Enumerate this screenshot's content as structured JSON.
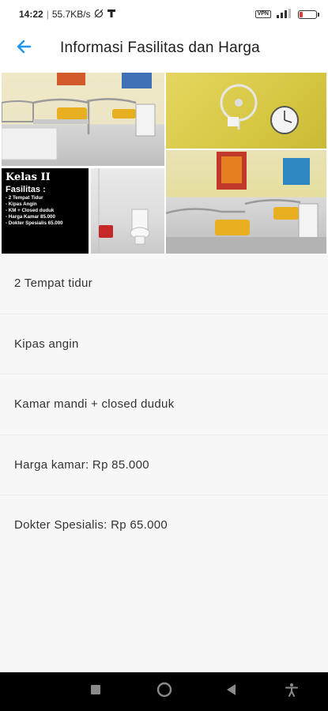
{
  "status_bar": {
    "time": "14:22",
    "network_speed": "55.7KB/s",
    "vpn_label": "VPN",
    "battery_level": 0.2,
    "battery_color": "#e53935"
  },
  "app_bar": {
    "title": "Informasi Fasilitas dan Harga",
    "back_icon": "arrow-left-icon",
    "accent_color": "#2196f3"
  },
  "photo_card": {
    "heading": "Kelas II",
    "facilities_label": "Fasilitas :",
    "lines": [
      "- 2 Tempat Tidur",
      "- Kipas Angin",
      "- KM + Closed duduk",
      "- Harga Kamar 85.000",
      "- Dokter Spesialis 65.000"
    ]
  },
  "facilities": [
    "2 Tempat tidur",
    "Kipas angin",
    "Kamar mandi + closed duduk",
    "Harga kamar: Rp 85.000",
    "Dokter Spesialis: Rp 65.000"
  ],
  "nav_bar": {
    "icons": [
      "square-recents-icon",
      "circle-home-icon",
      "triangle-back-icon",
      "accessibility-icon"
    ]
  }
}
